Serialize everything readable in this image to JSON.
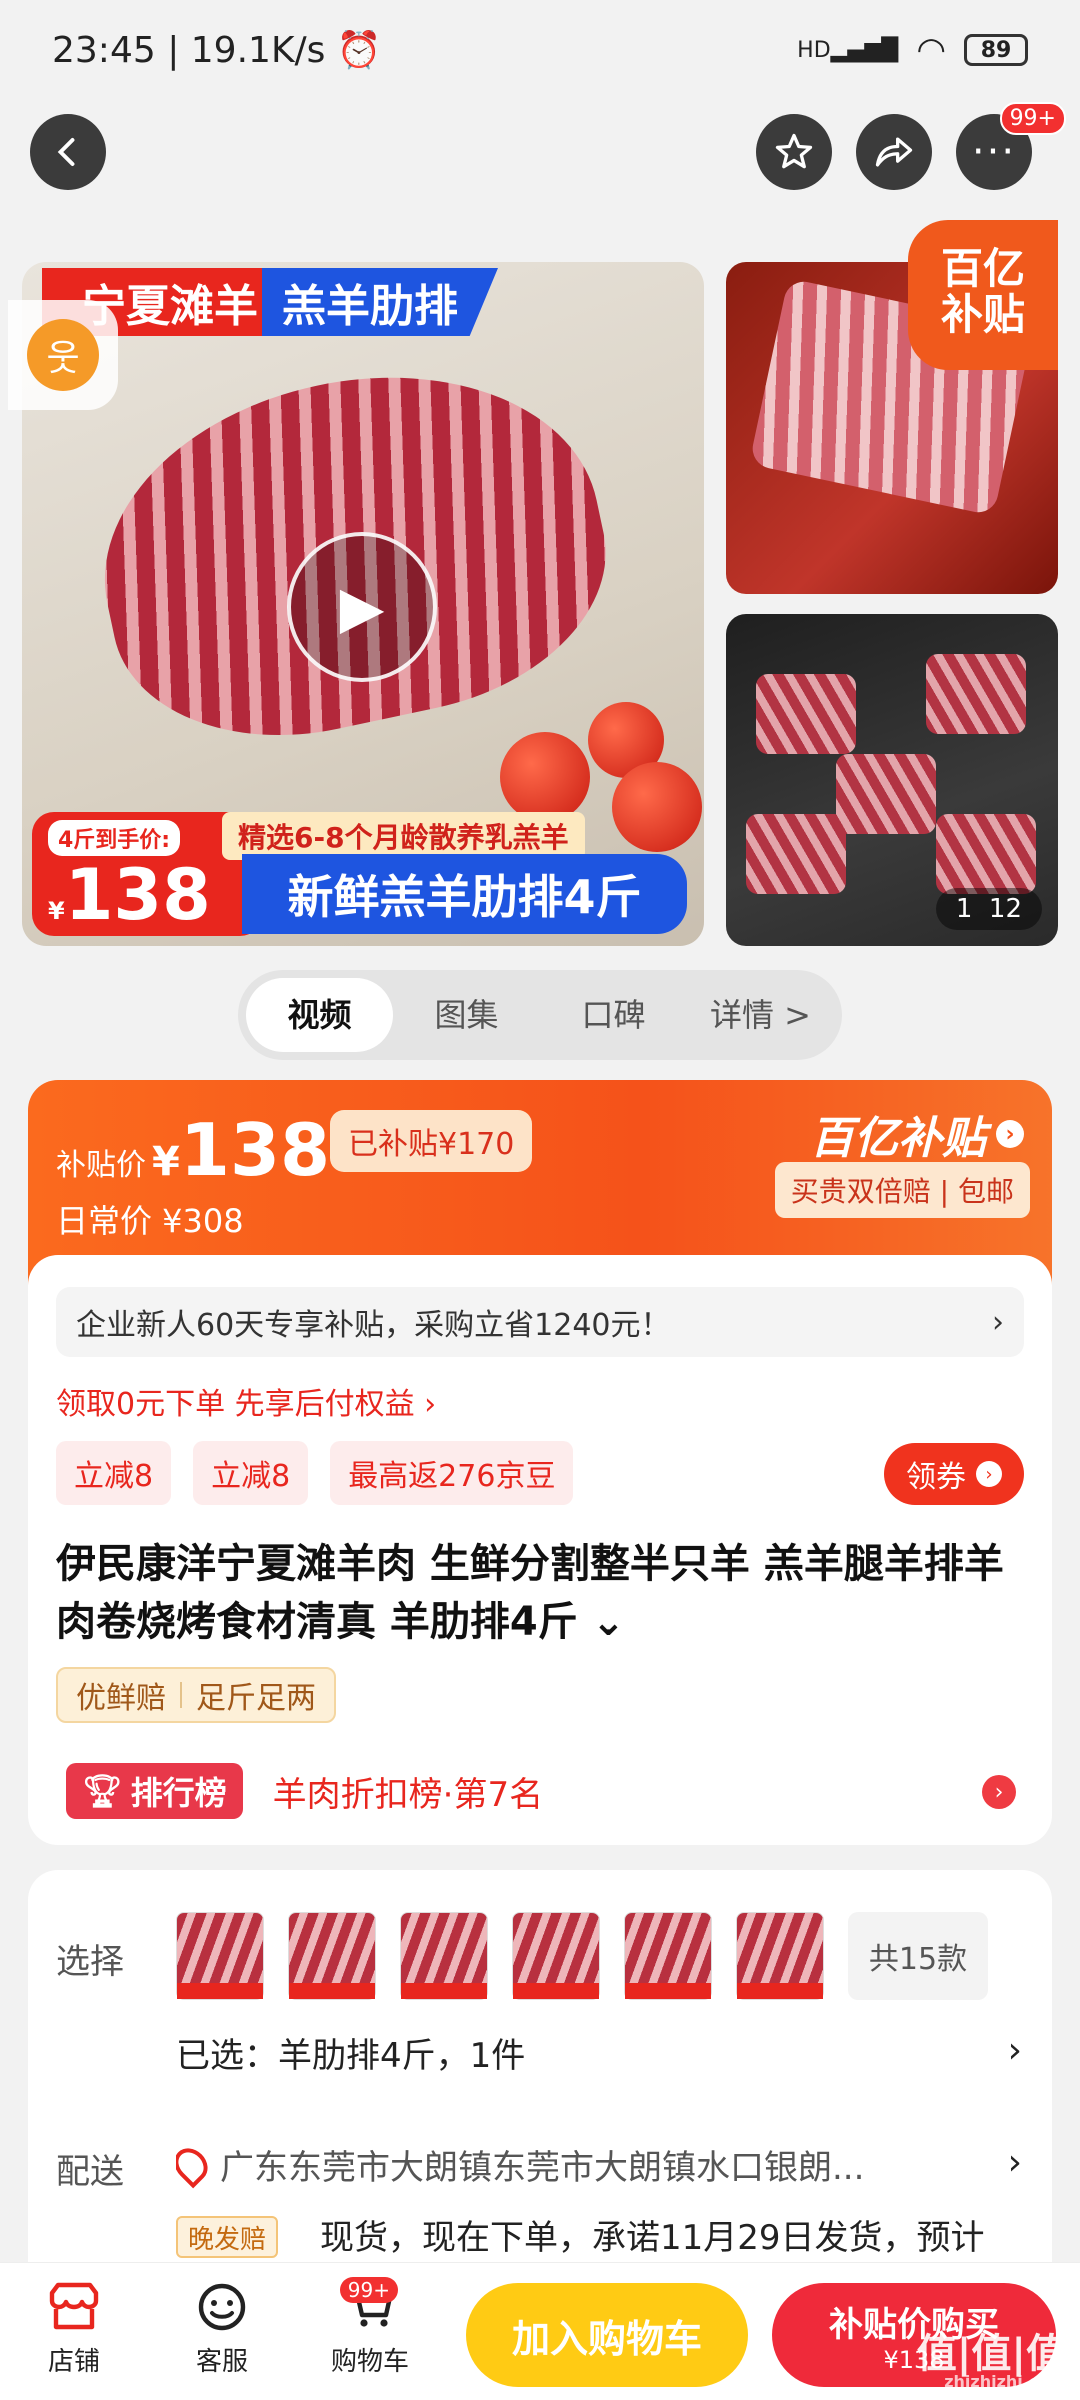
{
  "status_bar": {
    "time": "23:45",
    "net_speed": "19.1K/s",
    "battery": "89",
    "signal_label": "HD"
  },
  "nav": {
    "more_badge": "99+"
  },
  "gallery": {
    "tag_left": "宁夏滩羊",
    "tag_right": "羔羊肋排",
    "price_label": "4斤到手价:",
    "price_yen": "¥",
    "price_value": "138",
    "sub_banner": "精选6-8个月龄散养乳羔羊",
    "main_banner": "新鲜羔羊肋排4斤",
    "subsidy_corner": "百亿补贴",
    "page_current": "1",
    "page_total": "12"
  },
  "tabs": [
    {
      "label": "视频"
    },
    {
      "label": "图集"
    },
    {
      "label": "口碑"
    },
    {
      "label": "详情 >"
    }
  ],
  "price_card": {
    "label": "补贴价",
    "yen": "¥",
    "price": "138",
    "saved": "已补贴¥170",
    "daily": "日常价 ¥308",
    "logo": "百亿补贴",
    "sub": "买贵双倍赔 | 包邮"
  },
  "info": {
    "promo": "企业新人60天专享补贴，采购立省1240元！",
    "promo_arrow": "›",
    "pay_later": "领取0元下单 先享后付权益 ›",
    "coupons": [
      "立减8",
      "立减8",
      "最高返276京豆"
    ],
    "get_coupon": "领券",
    "title": "伊民康洋宁夏滩羊肉 生鲜分割整半只羊 羔羊腿羊排羊肉卷烧烤食材清真 羊肋排4斤 ⌄",
    "guarantee_1": "优鲜赔",
    "guarantee_2": "足斤足两",
    "rank_badge": "排行榜",
    "rank_text": "羊肉折扣榜·第7名"
  },
  "select": {
    "label": "选择",
    "count": "共15款",
    "selected": "已选：羊肋排4斤，1件",
    "delivery_label": "配送",
    "address": "广东东莞市大朗镇东莞市大朗镇水口银朗...",
    "late_tag": "晚发赔",
    "ship_text": "现货，现在下单，承诺11月29日发货，预计"
  },
  "bottom_bar": {
    "shop": "店铺",
    "service": "客服",
    "cart": "购物车",
    "cart_badge": "99+",
    "add_cart": "加入购物车",
    "buy_l1": "补贴价购买",
    "buy_l2": "¥138"
  },
  "watermark": {
    "main": "值|值|值",
    "sub": "zhizhizhi.com"
  },
  "colors": {
    "accent_red": "#e8261e",
    "subsidy_orange": "#f5521a",
    "cart_yellow": "#ffcb14",
    "buy_red": "#ef2a3a"
  }
}
